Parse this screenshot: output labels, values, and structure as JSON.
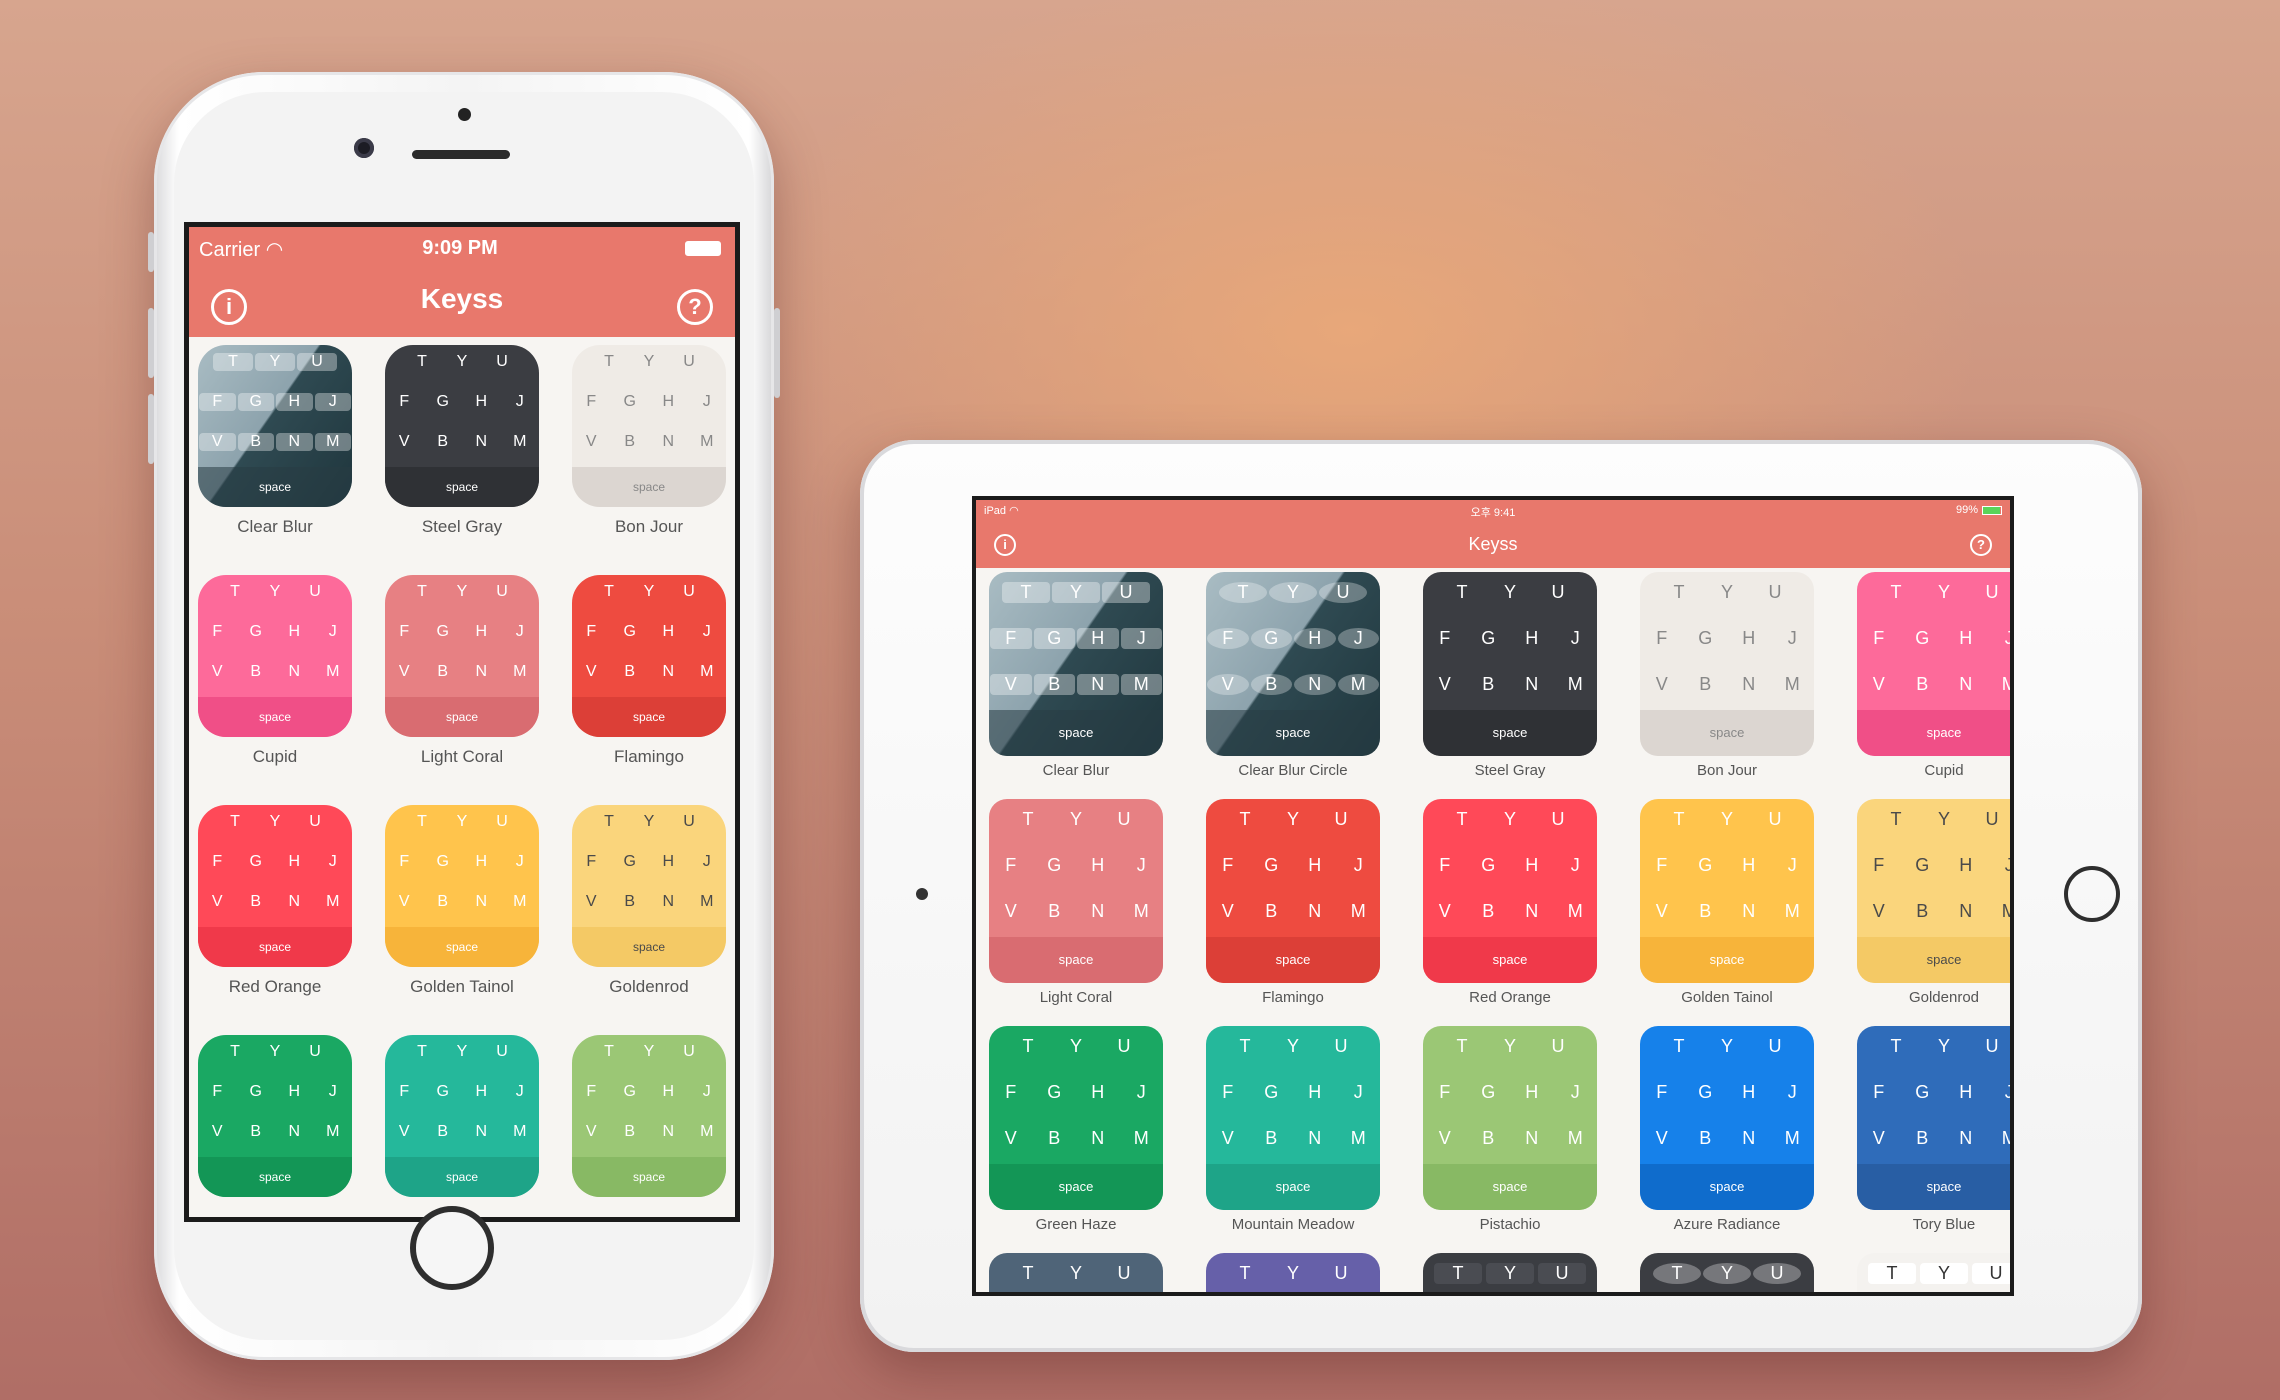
{
  "iphone": {
    "status": {
      "carrier": "Carrier",
      "time": "9:09 PM"
    },
    "title": "Keyss",
    "info_icon": "i",
    "help_icon": "?",
    "themes": [
      {
        "name": "Clear Blur",
        "color": "#6d8794",
        "key_color": "#ffffff",
        "bar": "#55707c",
        "style": "blur"
      },
      {
        "name": "Steel Gray",
        "color": "#3b3d42",
        "key_color": "#ffffff",
        "bar": "#2f3135"
      },
      {
        "name": "Bon Jour",
        "color": "#efebe6",
        "key_color": "#888888",
        "bar": "#dcd6d1"
      },
      {
        "name": "Cupid",
        "color": "#fd6a9a",
        "key_color": "#ffffff",
        "bar": "#f04f87"
      },
      {
        "name": "Light Coral",
        "color": "#e78083",
        "key_color": "#ffffff",
        "bar": "#d96c71"
      },
      {
        "name": "Flamingo",
        "color": "#ee4b40",
        "key_color": "#ffffff",
        "bar": "#dc3f37"
      },
      {
        "name": "Red Orange",
        "color": "#ff4958",
        "key_color": "#ffffff",
        "bar": "#f0394a"
      },
      {
        "name": "Golden Tainol",
        "color": "#ffc44c",
        "key_color": "#ffffff",
        "bar": "#f7b43a"
      },
      {
        "name": "Goldenrod",
        "color": "#fad57c",
        "key_color": "#4a4a4a",
        "bar": "#f4c965"
      },
      {
        "name": "",
        "color": "#1aa863",
        "key_color": "#ffffff",
        "bar": "#139656"
      },
      {
        "name": "",
        "color": "#25b89b",
        "key_color": "#ffffff",
        "bar": "#1ea488"
      },
      {
        "name": "",
        "color": "#9bc775",
        "key_color": "#ffffff",
        "bar": "#88b964"
      }
    ]
  },
  "ipad": {
    "status": {
      "carrier": "iPad",
      "time": "오후 9:41",
      "battery": "99%"
    },
    "title": "Keyss",
    "info_icon": "i",
    "help_icon": "?",
    "themes": [
      {
        "name": "Clear Blur",
        "color": "#6d8794",
        "key_color": "#ffffff",
        "bar": "#55707c",
        "style": "blur"
      },
      {
        "name": "Clear Blur Circle",
        "color": "#6d8794",
        "key_color": "#ffffff",
        "bar": "#55707c",
        "style": "blur-circle"
      },
      {
        "name": "Steel Gray",
        "color": "#3b3d42",
        "key_color": "#ffffff",
        "bar": "#2f3135"
      },
      {
        "name": "Bon Jour",
        "color": "#efebe6",
        "key_color": "#888888",
        "bar": "#dcd6d1"
      },
      {
        "name": "Cupid",
        "color": "#fd6a9a",
        "key_color": "#ffffff",
        "bar": "#f04f87"
      },
      {
        "name": "Light Coral",
        "color": "#e78083",
        "key_color": "#ffffff",
        "bar": "#d96c71"
      },
      {
        "name": "Flamingo",
        "color": "#ee4b40",
        "key_color": "#ffffff",
        "bar": "#dc3f37"
      },
      {
        "name": "Red Orange",
        "color": "#ff4958",
        "key_color": "#ffffff",
        "bar": "#f0394a"
      },
      {
        "name": "Golden Tainol",
        "color": "#ffc44c",
        "key_color": "#ffffff",
        "bar": "#f7b43a"
      },
      {
        "name": "Goldenrod",
        "color": "#fad57c",
        "key_color": "#4a4a4a",
        "bar": "#f4c965"
      },
      {
        "name": "Green Haze",
        "color": "#1aa863",
        "key_color": "#ffffff",
        "bar": "#139656"
      },
      {
        "name": "Mountain Meadow",
        "color": "#25b89b",
        "key_color": "#ffffff",
        "bar": "#1ea488"
      },
      {
        "name": "Pistachio",
        "color": "#9bc775",
        "key_color": "#ffffff",
        "bar": "#88b964"
      },
      {
        "name": "Azure Radiance",
        "color": "#1681ea",
        "key_color": "#ffffff",
        "bar": "#0f6ccc"
      },
      {
        "name": "Tory Blue",
        "color": "#2f6cba",
        "key_color": "#ffffff",
        "bar": "#285ea4"
      },
      {
        "name": "",
        "color": "#4f6478",
        "key_color": "#ffffff",
        "bar": "#435567"
      },
      {
        "name": "",
        "color": "#6660a9",
        "key_color": "#ffffff",
        "bar": "#58529a"
      },
      {
        "name": "",
        "color": "#3b3d42",
        "key_color": "#ffffff",
        "bar": "#2f3135",
        "style": "keycap-dark"
      },
      {
        "name": "",
        "color": "#3b3d42",
        "key_color": "#ffffff",
        "bar": "#2f3135",
        "style": "bubble-dark"
      },
      {
        "name": "",
        "color": "#f4f2ef",
        "key_color": "#333333",
        "bar": "#e1ddd8",
        "style": "keycap-light"
      }
    ]
  },
  "keyboard": {
    "row1": [
      "T",
      "Y",
      "U"
    ],
    "row2": [
      "F",
      "G",
      "H",
      "J"
    ],
    "row3": [
      "V",
      "B",
      "N",
      "M"
    ],
    "space": "space"
  }
}
